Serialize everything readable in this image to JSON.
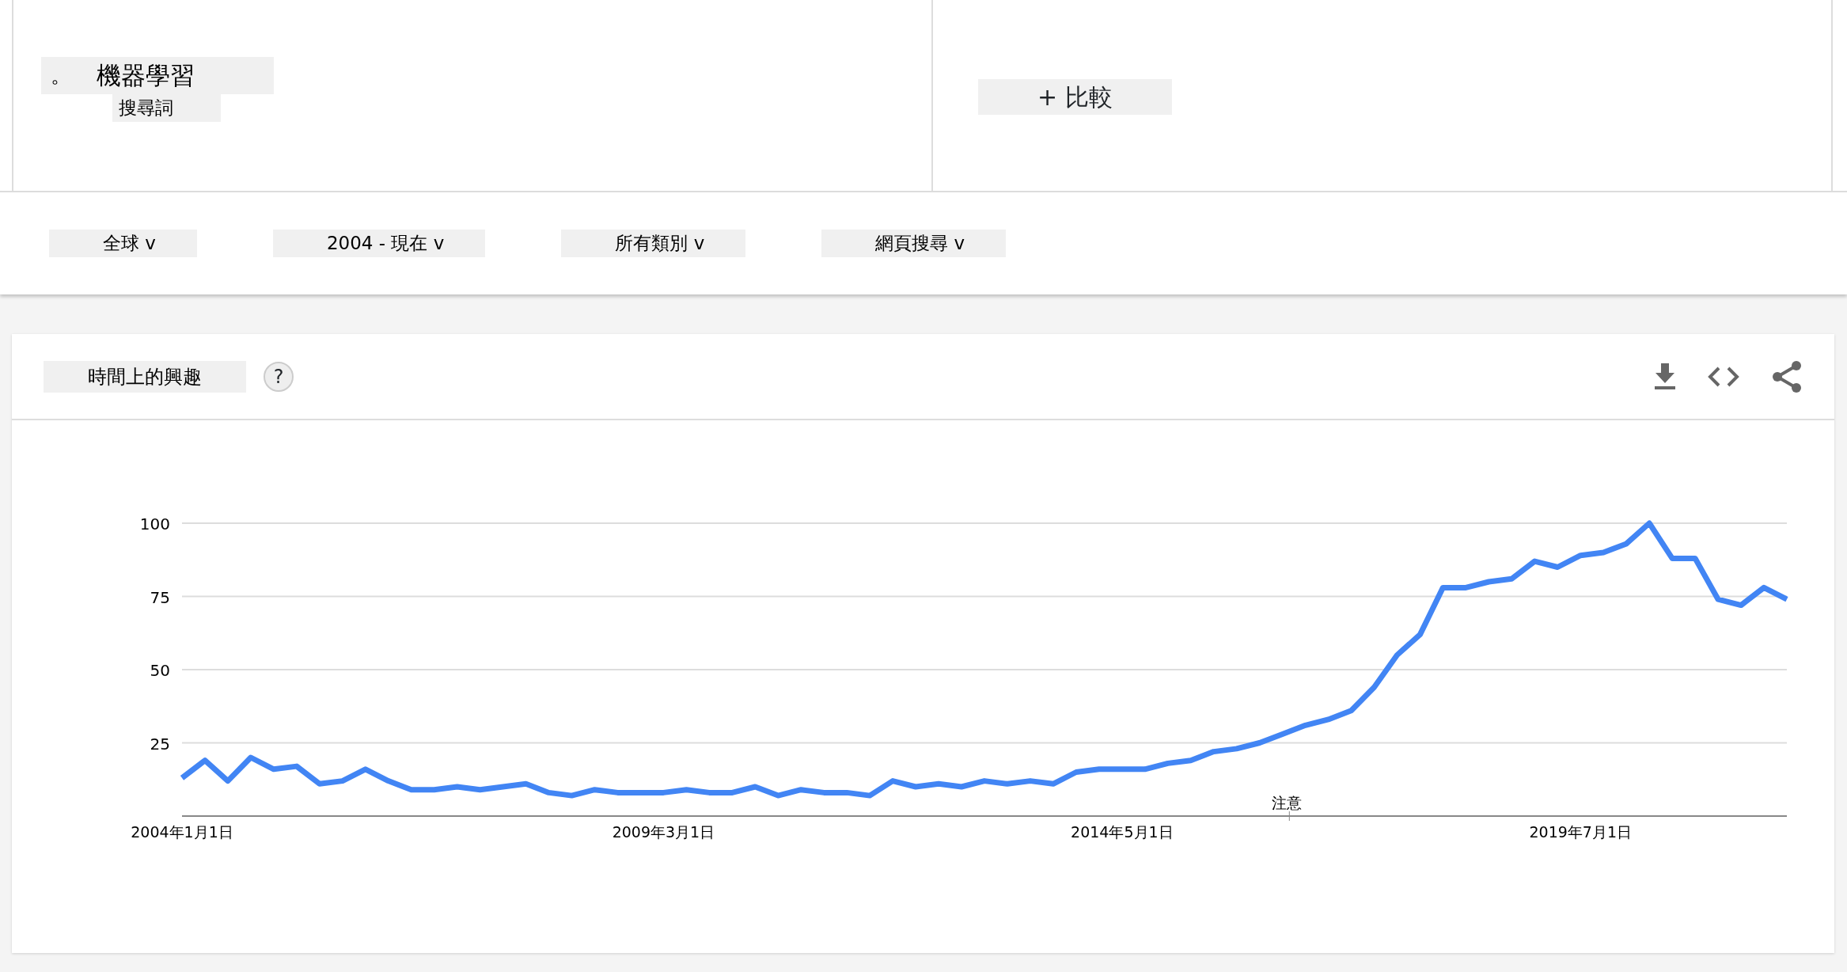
{
  "search_term": {
    "marker": "。",
    "term": "機器學習",
    "subtitle": "搜尋詞"
  },
  "compare_button": "+ 比較",
  "filters": [
    "全球 v",
    "2004 - 現在 v",
    "所有類別 v",
    "網頁搜尋 v"
  ],
  "interest_card": {
    "title": "時間上的興趣",
    "help": "?",
    "chart_data": {
      "type": "line",
      "grid": true,
      "ylim": [
        0,
        100
      ],
      "yticks": [
        25,
        50,
        75,
        100
      ],
      "categories": [
        "2004年1月1日",
        null,
        null,
        null,
        null,
        null,
        null,
        null,
        null,
        null,
        null,
        null,
        null,
        null,
        null,
        null,
        null,
        null,
        null,
        null,
        null,
        "2009年3月1日",
        null,
        null,
        null,
        null,
        null,
        null,
        null,
        null,
        null,
        null,
        null,
        null,
        null,
        null,
        null,
        null,
        null,
        null,
        null,
        "2014年5月1日",
        null,
        null,
        null,
        null,
        null,
        null,
        null,
        null,
        null,
        null,
        null,
        null,
        null,
        null,
        null,
        null,
        null,
        null,
        null,
        "2019年7月1日",
        null,
        null,
        null,
        null,
        null,
        null,
        null,
        null,
        null
      ],
      "series": [
        {
          "color": "#4285f4",
          "values": [
            13,
            19,
            12,
            20,
            16,
            17,
            11,
            12,
            16,
            12,
            9,
            9,
            10,
            9,
            10,
            11,
            8,
            7,
            9,
            8,
            8,
            8,
            9,
            8,
            8,
            10,
            7,
            9,
            8,
            8,
            7,
            12,
            10,
            11,
            10,
            12,
            11,
            12,
            11,
            15,
            16,
            16,
            16,
            18,
            19,
            22,
            23,
            25,
            28,
            31,
            33,
            36,
            44,
            55,
            62,
            78,
            78,
            80,
            81,
            87,
            85,
            89,
            90,
            93,
            100,
            88,
            88,
            74,
            72,
            78,
            74
          ]
        }
      ],
      "annotations": [
        "注意"
      ]
    }
  }
}
